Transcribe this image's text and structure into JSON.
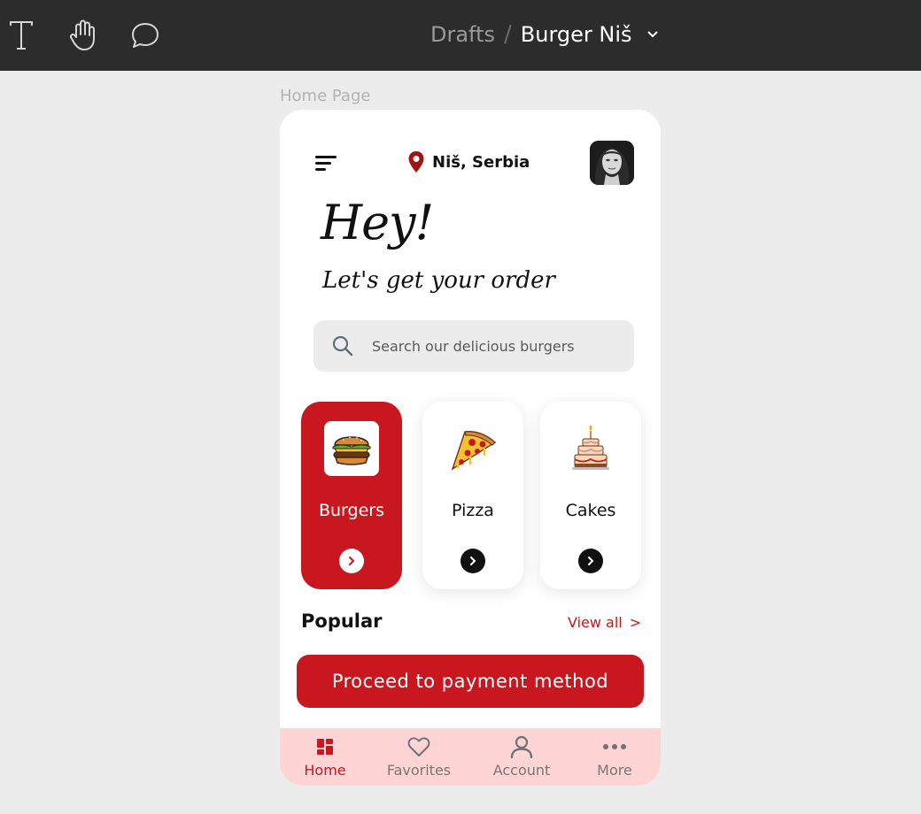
{
  "toolbar": {
    "tools": [
      {
        "name": "text-tool",
        "icon": "text-icon"
      },
      {
        "name": "hand-tool",
        "icon": "hand-icon"
      },
      {
        "name": "comment-tool",
        "icon": "comment-icon"
      }
    ],
    "breadcrumb": {
      "parent": "Drafts",
      "separator": "/",
      "file": "Burger Niš"
    }
  },
  "frame": {
    "label": "Home Page"
  },
  "header": {
    "location": "Niš, Serbia",
    "location_icon": "map-pin-icon",
    "menu_icon": "menu-icon",
    "avatar": "user-avatar"
  },
  "greeting": {
    "title": "Hey!",
    "subtitle": "Let's get your order"
  },
  "search": {
    "placeholder": "Search our delicious burgers",
    "value": ""
  },
  "categories": [
    {
      "label": "Burgers",
      "icon": "burger-icon",
      "active": true
    },
    {
      "label": "Pizza",
      "icon": "pizza-icon",
      "active": false
    },
    {
      "label": "Cakes",
      "icon": "cake-icon",
      "active": false
    }
  ],
  "popular": {
    "title": "Popular",
    "view_all": "View all",
    "view_all_chevron": ">"
  },
  "cta": {
    "label": "Proceed to payment method"
  },
  "nav": [
    {
      "label": "Home",
      "icon": "grid-icon",
      "active": true
    },
    {
      "label": "Favorites",
      "icon": "heart-icon",
      "active": false
    },
    {
      "label": "Account",
      "icon": "user-icon",
      "active": false
    },
    {
      "label": "More",
      "icon": "more-icon",
      "active": false
    }
  ],
  "colors": {
    "toolbar": "#2c2c2c",
    "canvas": "#ececec",
    "accent": "#c8171e",
    "nav_bg": "#ffd4d4"
  }
}
